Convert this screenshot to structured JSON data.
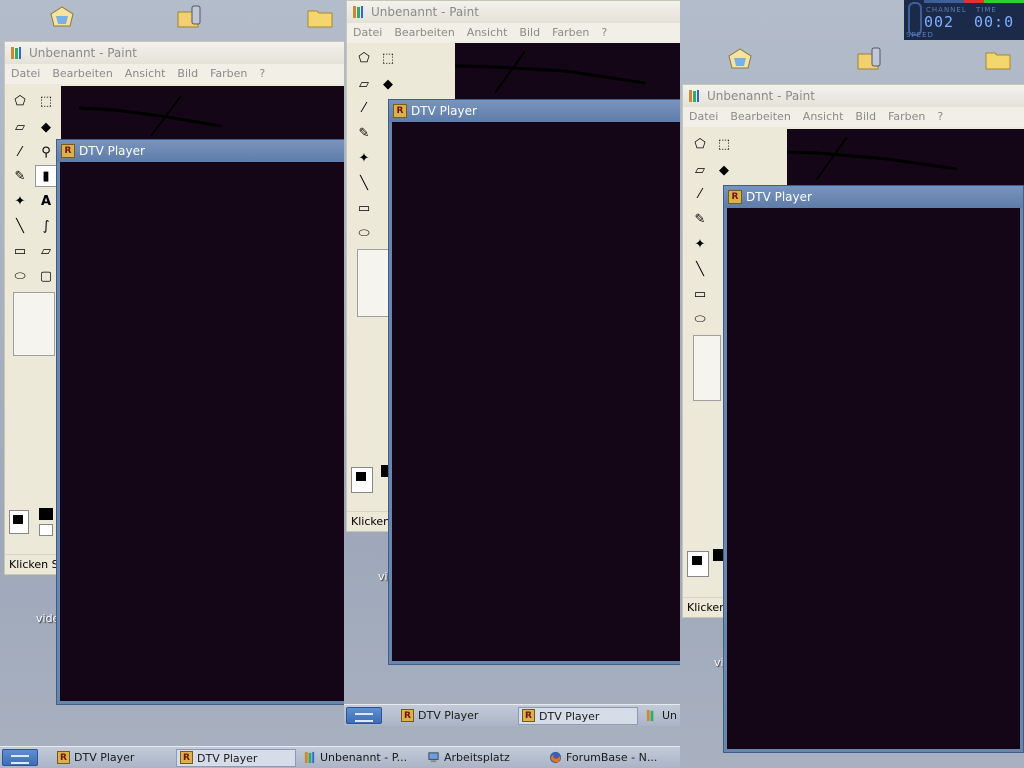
{
  "colors": {
    "dtv_titlebar": "#6b86ad",
    "canvas_dark": "#140616",
    "paint_chrome": "#ece9d8",
    "taskbar": "#b4bdcd"
  },
  "paint": {
    "title": "Unbenannt - Paint",
    "menu": [
      "Datei",
      "Bearbeiten",
      "Ansicht",
      "Bild",
      "Farben",
      "?"
    ],
    "status_full": "Klicken Sie",
    "status_a": "Klicken S",
    "status_b": "Klicken S"
  },
  "dtv": {
    "title": "DTV Player"
  },
  "desktop": {
    "caption_left": "vide",
    "caption_mid": "vi",
    "caption_right": "vi"
  },
  "widget": {
    "label_channel": "CHANNEL",
    "label_time": "TIME",
    "label_speed": "SPEED",
    "channel": "002",
    "time": "00:0"
  },
  "taskbar_main": {
    "items": [
      "DTV Player",
      "DTV Player",
      "Unbenannt - P...",
      "Arbeitsplatz",
      "ForumBase - N..."
    ]
  },
  "taskbar_mid": {
    "items": [
      "DTV Player",
      "DTV Player",
      "Un"
    ]
  },
  "icons": [
    "briefcase-icon",
    "phone-folder-icon",
    "folder-icon",
    "paint-app-icon",
    "dtv-app-icon",
    "start-button-icon",
    "my-computer-icon",
    "firefox-icon"
  ]
}
